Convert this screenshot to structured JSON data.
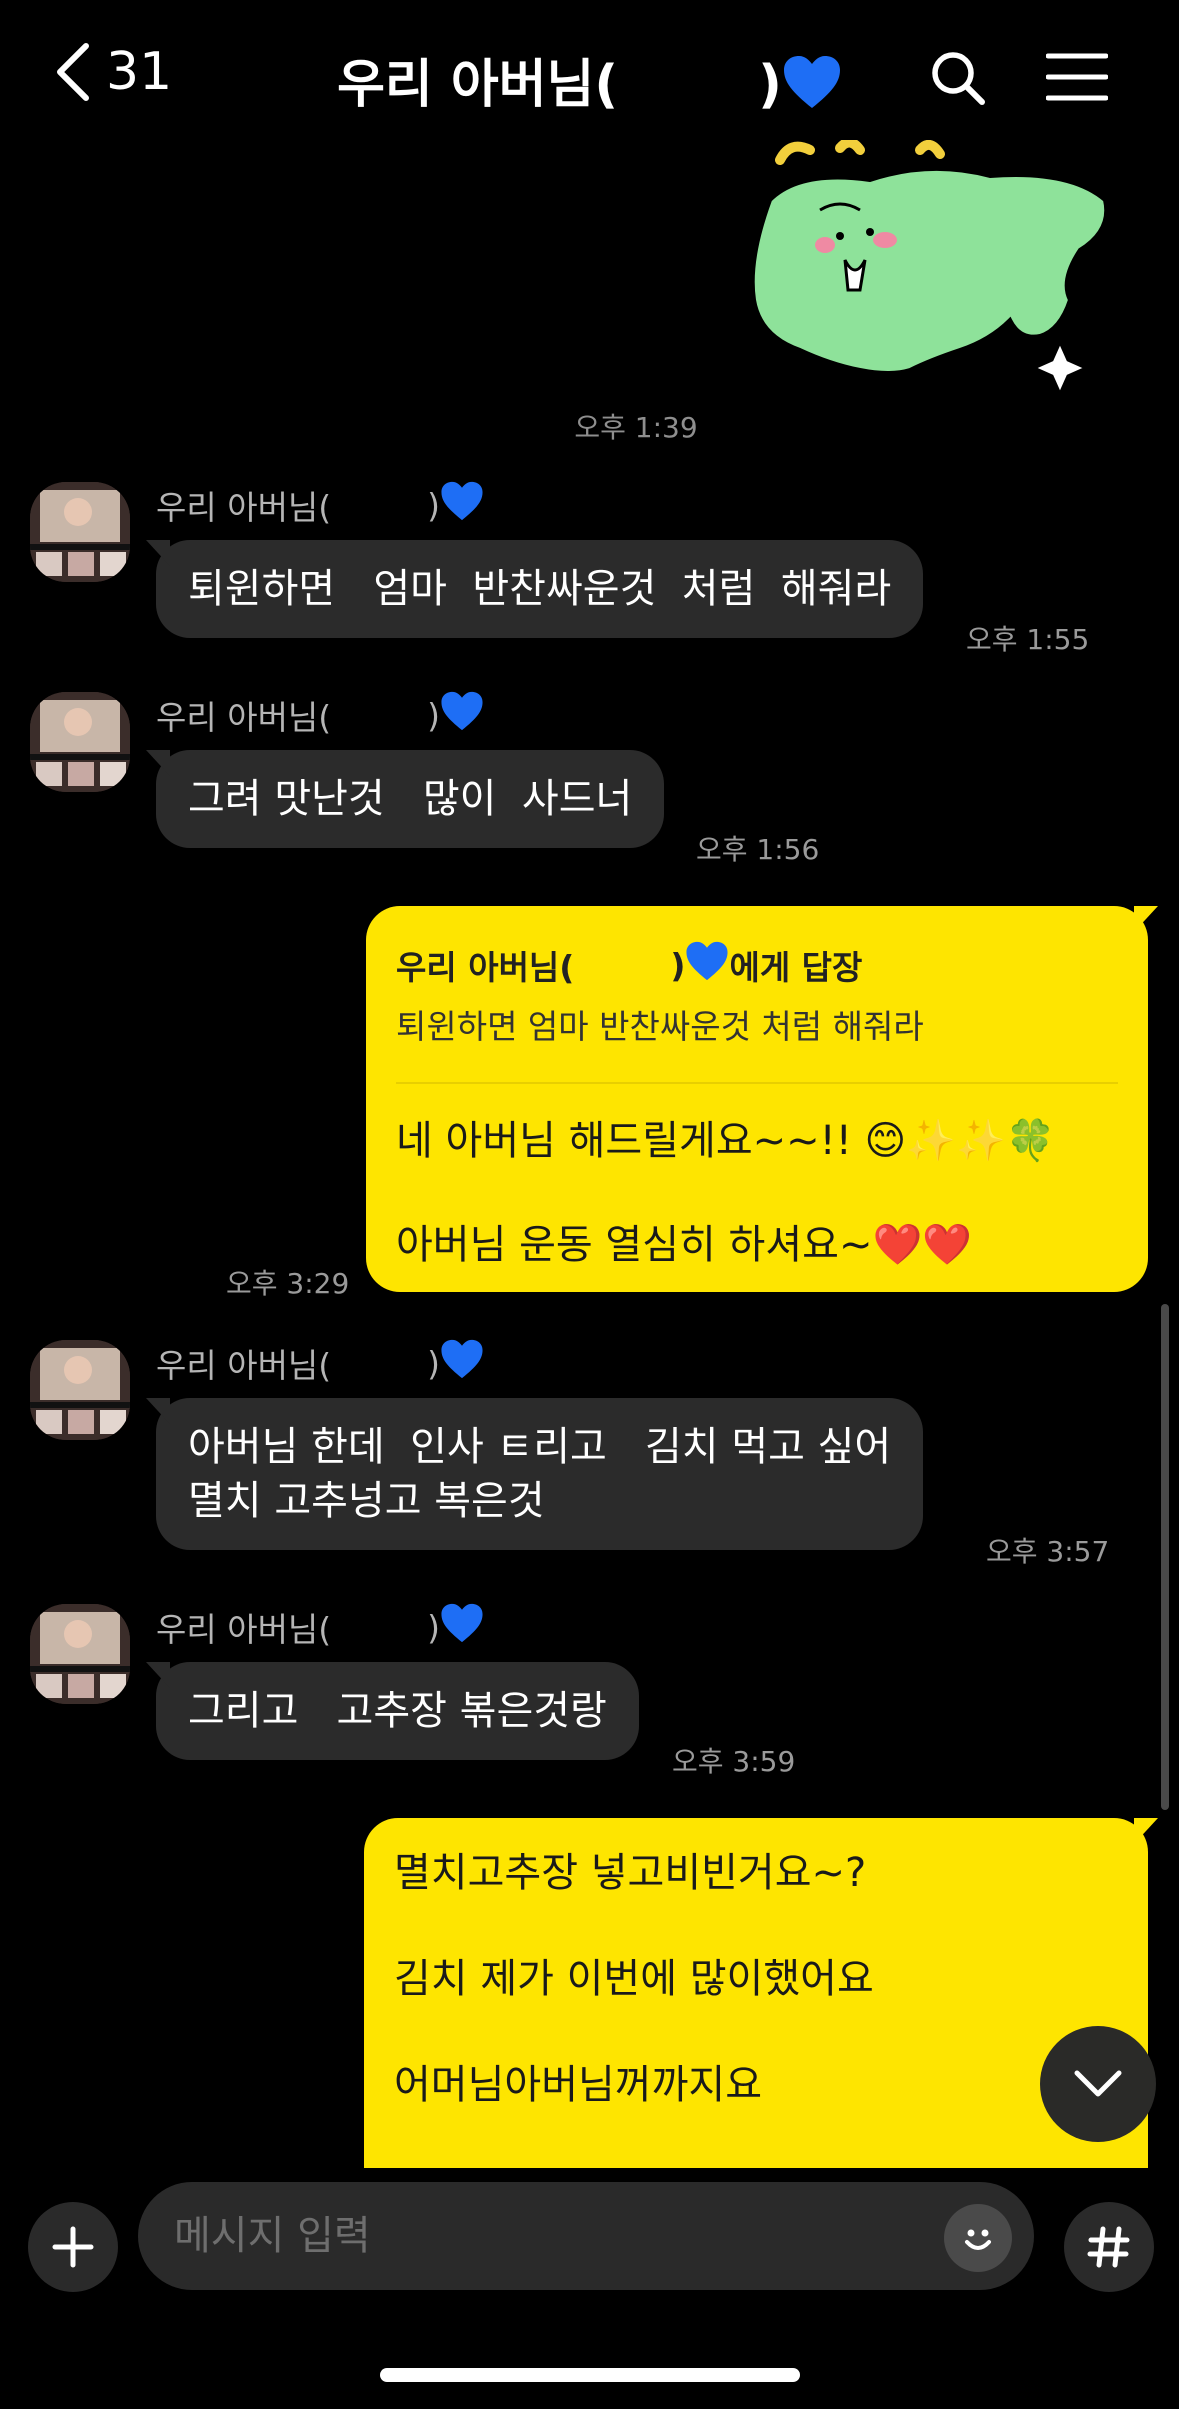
{
  "header": {
    "back_count": "31",
    "title_prefix": "우리 아버님(",
    "title_suffix": ")"
  },
  "sticker": {
    "icon": "green-blob-sticker"
  },
  "timestamps": {
    "sticker_time": "오후 1:39"
  },
  "messages": [
    {
      "sender_prefix": "우리 아버님(",
      "sender_suffix": ")",
      "text": "퇴윈하면   엄마  반찬싸운것  처럼  해줘라",
      "time": "오후 1:55"
    },
    {
      "sender_prefix": "우리 아버님(",
      "sender_suffix": ")",
      "text": "그려 맛난것   많이  사드너",
      "time": "오후 1:56"
    },
    {
      "reply_to_prefix": "우리 아버님(",
      "reply_to_suffix": ")",
      "reply_label": "에게 답장",
      "quote": "퇴윈하면   엄마  반찬싸운것  처럼  해줘라",
      "line1": "네 아버님 해드릴게요~~!! 😊✨✨🍀",
      "line2": "아버님 운동 열심히 하셔요~❤️❤️",
      "time": "오후 3:29"
    },
    {
      "sender_prefix": "우리 아버님(",
      "sender_suffix": ")",
      "text": "아버님 한데  인사 ㅌ리고   김치 먹고 싶어\n멸치 고추넝고 복은것",
      "time": "오후 3:57"
    },
    {
      "sender_prefix": "우리 아버님(",
      "sender_suffix": ")",
      "text": "그리고   고추장 볶은것랑",
      "time": "오후 3:59"
    },
    {
      "line1": "멸치고추장 넣고비빈거요~?",
      "line2": "김치 제가 이번에 많이했어요",
      "line3": "어머님아버님꺼까지요"
    }
  ],
  "input": {
    "placeholder": "메시지 입력"
  },
  "colors": {
    "my_bubble": "#fee500",
    "their_bubble": "#2b2b2b",
    "heart": "#1e6ef5",
    "background": "#000000"
  }
}
